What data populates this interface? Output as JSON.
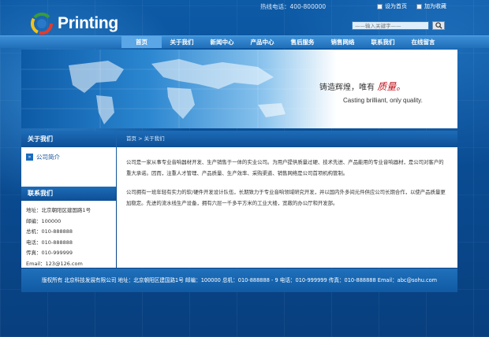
{
  "header": {
    "logo_text": "Printing",
    "hotline": "热线电话：400-800000",
    "toplinks": [
      "设为首页",
      "加为收藏"
    ],
    "search_placeholder": "——输入关键字——"
  },
  "nav": {
    "items": [
      "首页",
      "关于我们",
      "新闻中心",
      "产品中心",
      "售后服务",
      "销售网络",
      "联系我们",
      "在线留言"
    ],
    "active_index": 0
  },
  "banner": {
    "slogan_prefix": "铸造辉煌，唯有",
    "slogan_highlight": "质量。",
    "slogan_en": "Casting brilliant, only quality."
  },
  "sidebar": {
    "about_title": "关于我们",
    "menu": [
      "公司简介"
    ],
    "contact_title": "联系我们",
    "contact": [
      "地址：北京朝阳区建国路1号",
      "邮编：100000",
      "总机：010-888888",
      "电话：010-888888",
      "传真：010-999999",
      "Email：123@126.com"
    ]
  },
  "main": {
    "breadcrumb": "首页 > 关于我们",
    "paragraphs": [
      "公司是一家从事专业音响器材开发、生产销售于一体的实业公司。为用户提供质量过硬、技术先进、产品能用的专业音响器材，是公司对客户的重大承诺。因而，注重人才管理、产品质量、生产效率、采购渠道、销售网络是公司首项机构管制。",
      "公司拥有一班年轻有实力的软/硬件开发设计队伍，长期致力于专业音响领域研究开发，并以国内外多间元件供应公司长期合作，以使产品质量更加稳定。先进的流水线生产设备，拥有六层一千多平方米的工业大楼，宽敞的办公厅和开发部。"
    ]
  },
  "footer": {
    "text": "版权所有   北京科技发展有限公司  地址：北京朝阳区建国路1号  邮编：100000     总机：010-888888 - 9  电话：010-999999  传真：010-888888  Email：abc@sohu.com"
  },
  "colors": {
    "primary_blue": "#0a4a8c",
    "nav_blue": "#1f6fb9",
    "nav_active": "#5aa6e6",
    "slogan_red": "#c0101a"
  }
}
